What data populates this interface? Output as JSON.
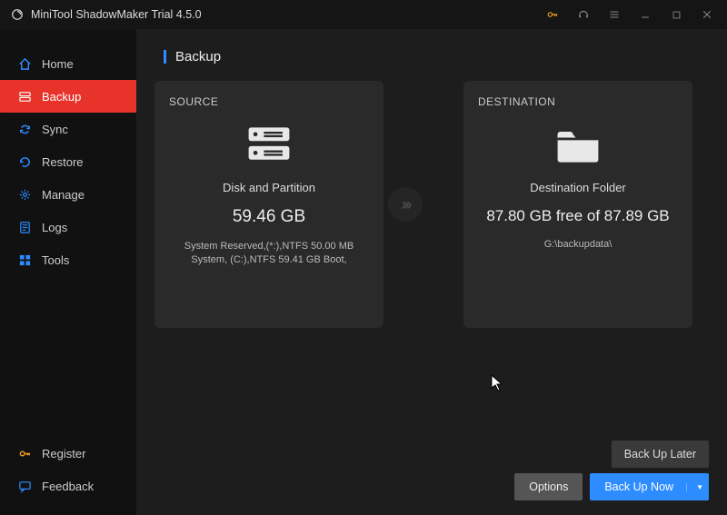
{
  "app": {
    "title": "MiniTool ShadowMaker Trial 4.5.0"
  },
  "sidebar": {
    "items": [
      {
        "label": "Home"
      },
      {
        "label": "Backup"
      },
      {
        "label": "Sync"
      },
      {
        "label": "Restore"
      },
      {
        "label": "Manage"
      },
      {
        "label": "Logs"
      },
      {
        "label": "Tools"
      }
    ],
    "bottom": [
      {
        "label": "Register"
      },
      {
        "label": "Feedback"
      }
    ]
  },
  "page": {
    "title": "Backup"
  },
  "source": {
    "heading": "SOURCE",
    "title": "Disk and Partition",
    "size": "59.46 GB",
    "detail": "System Reserved,(*:),NTFS 50.00 MB System, (C:),NTFS 59.41 GB Boot,"
  },
  "destination": {
    "heading": "DESTINATION",
    "title": "Destination Folder",
    "size": "87.80 GB free of 87.89 GB",
    "detail": "G:\\backupdata\\"
  },
  "buttons": {
    "back_up_later": "Back Up Later",
    "options": "Options",
    "back_up_now": "Back Up Now"
  }
}
